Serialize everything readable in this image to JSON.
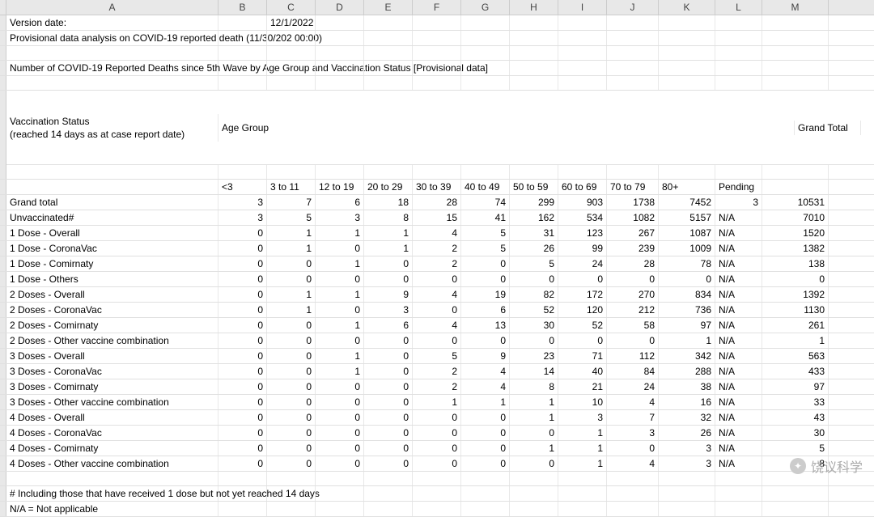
{
  "columns": [
    "A",
    "B",
    "C",
    "D",
    "E",
    "F",
    "G",
    "H",
    "I",
    "J",
    "K",
    "L",
    "M"
  ],
  "meta": {
    "version_label": "Version date:",
    "version_value": "12/1/2022",
    "provisional_label": "Provisional data analysis on COVID-19 reported death (11/30/202 00:00)",
    "title": "Number of COVID-19 Reported Deaths since 5th Wave by Age Group and Vaccination Status [Provisional data]",
    "vax_status_header1": "Vaccination Status",
    "vax_status_header2": "(reached 14 days as at case report date)",
    "age_group_header": "Age Group",
    "grand_total_header": "Grand Total"
  },
  "age_columns": [
    "<3",
    "3 to 11",
    "12 to 19",
    "20 to 29",
    "30 to 39",
    "40 to 49",
    "50 to 59",
    "60 to 69",
    "70 to 79",
    "80+",
    "Pending"
  ],
  "rows": [
    {
      "label": "Grand total",
      "v": [
        "3",
        "7",
        "6",
        "18",
        "28",
        "74",
        "299",
        "903",
        "1738",
        "7452",
        "3"
      ],
      "gt": "10531"
    },
    {
      "label": "Unvaccinated#",
      "v": [
        "3",
        "5",
        "3",
        "8",
        "15",
        "41",
        "162",
        "534",
        "1082",
        "5157",
        "N/A"
      ],
      "gt": "7010"
    },
    {
      "label": "1 Dose - Overall",
      "v": [
        "0",
        "1",
        "1",
        "1",
        "4",
        "5",
        "31",
        "123",
        "267",
        "1087",
        "N/A"
      ],
      "gt": "1520"
    },
    {
      "label": "1 Dose - CoronaVac",
      "v": [
        "0",
        "1",
        "0",
        "1",
        "2",
        "5",
        "26",
        "99",
        "239",
        "1009",
        "N/A"
      ],
      "gt": "1382"
    },
    {
      "label": "1 Dose - Comirnaty",
      "v": [
        "0",
        "0",
        "1",
        "0",
        "2",
        "0",
        "5",
        "24",
        "28",
        "78",
        "N/A"
      ],
      "gt": "138"
    },
    {
      "label": "1 Dose - Others",
      "v": [
        "0",
        "0",
        "0",
        "0",
        "0",
        "0",
        "0",
        "0",
        "0",
        "0",
        "N/A"
      ],
      "gt": "0"
    },
    {
      "label": "2 Doses - Overall",
      "v": [
        "0",
        "1",
        "1",
        "9",
        "4",
        "19",
        "82",
        "172",
        "270",
        "834",
        "N/A"
      ],
      "gt": "1392"
    },
    {
      "label": "2 Doses - CoronaVac",
      "v": [
        "0",
        "1",
        "0",
        "3",
        "0",
        "6",
        "52",
        "120",
        "212",
        "736",
        "N/A"
      ],
      "gt": "1130"
    },
    {
      "label": "2 Doses - Comirnaty",
      "v": [
        "0",
        "0",
        "1",
        "6",
        "4",
        "13",
        "30",
        "52",
        "58",
        "97",
        "N/A"
      ],
      "gt": "261"
    },
    {
      "label": "2 Doses - Other vaccine combination",
      "v": [
        "0",
        "0",
        "0",
        "0",
        "0",
        "0",
        "0",
        "0",
        "0",
        "1",
        "N/A"
      ],
      "gt": "1"
    },
    {
      "label": "3 Doses - Overall",
      "v": [
        "0",
        "0",
        "1",
        "0",
        "5",
        "9",
        "23",
        "71",
        "112",
        "342",
        "N/A"
      ],
      "gt": "563"
    },
    {
      "label": "3 Doses - CoronaVac",
      "v": [
        "0",
        "0",
        "1",
        "0",
        "2",
        "4",
        "14",
        "40",
        "84",
        "288",
        "N/A"
      ],
      "gt": "433"
    },
    {
      "label": "3 Doses - Comirnaty",
      "v": [
        "0",
        "0",
        "0",
        "0",
        "2",
        "4",
        "8",
        "21",
        "24",
        "38",
        "N/A"
      ],
      "gt": "97"
    },
    {
      "label": "3 Doses - Other vaccine combination",
      "v": [
        "0",
        "0",
        "0",
        "0",
        "1",
        "1",
        "1",
        "10",
        "4",
        "16",
        "N/A"
      ],
      "gt": "33"
    },
    {
      "label": "4 Doses - Overall",
      "v": [
        "0",
        "0",
        "0",
        "0",
        "0",
        "0",
        "1",
        "3",
        "7",
        "32",
        "N/A"
      ],
      "gt": "43"
    },
    {
      "label": "4 Doses - CoronaVac",
      "v": [
        "0",
        "0",
        "0",
        "0",
        "0",
        "0",
        "0",
        "1",
        "3",
        "26",
        "N/A"
      ],
      "gt": "30"
    },
    {
      "label": "4 Doses - Comirnaty",
      "v": [
        "0",
        "0",
        "0",
        "0",
        "0",
        "0",
        "1",
        "1",
        "0",
        "3",
        "N/A"
      ],
      "gt": "5"
    },
    {
      "label": "4 Doses - Other vaccine combination",
      "v": [
        "0",
        "0",
        "0",
        "0",
        "0",
        "0",
        "0",
        "1",
        "4",
        "3",
        "N/A"
      ],
      "gt": "8"
    }
  ],
  "footer": {
    "line1": "# Including those that have received 1 dose but not yet reached 14 days",
    "line2": "N/A = Not applicable"
  },
  "watermark": "饶议科学"
}
